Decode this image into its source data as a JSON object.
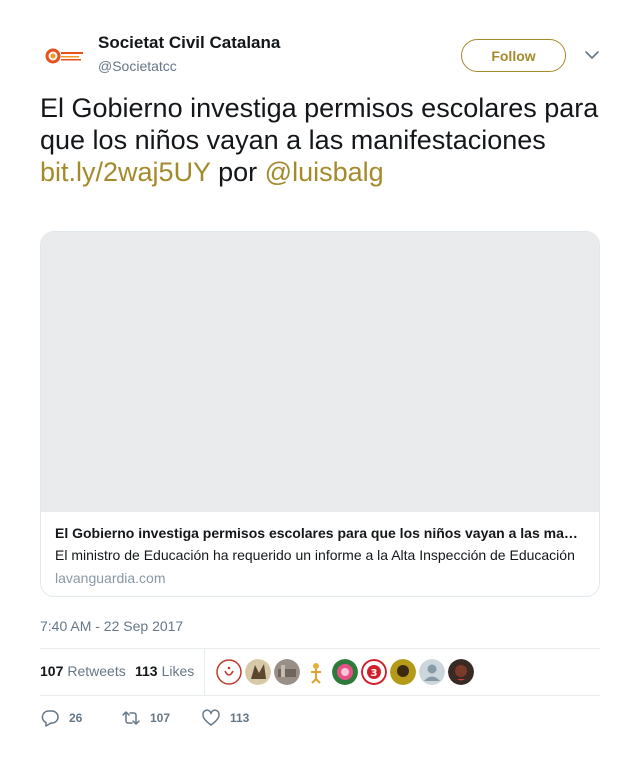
{
  "user": {
    "display_name": "Societat Civil Catalana",
    "handle": "@Societatcc",
    "avatar": "societat-civil-catalana-logo"
  },
  "follow_label": "Follow",
  "tweet": {
    "text_plain": "El Gobierno investiga permisos escolares para que los niños vayan a las manifestaciones",
    "link": "bit.ly/2waj5UY",
    "connector": "por",
    "mention": "@luisbalg"
  },
  "card": {
    "title": "El Gobierno investiga permisos escolares para que los niños vayan a las manifestaciones",
    "description": "El ministro de Educación ha requerido un informe a la Alta Inspección de Educación",
    "domain": "lavanguardia.com"
  },
  "timestamp": "7:40 AM - 22 Sep 2017",
  "stats": {
    "retweets_count": "107",
    "retweets_label": "Retweets",
    "likes_count": "113",
    "likes_label": "Likes"
  },
  "liker_avatars": [
    "liker-avatar-1",
    "liker-avatar-2",
    "liker-avatar-3",
    "liker-avatar-4",
    "liker-avatar-5",
    "liker-avatar-6",
    "liker-avatar-7",
    "liker-avatar-8",
    "liker-avatar-9"
  ],
  "actions": {
    "replies": "26",
    "retweets": "107",
    "likes": "113"
  },
  "colors": {
    "accent": "#a48a2b",
    "text": "#14171a",
    "muted": "#657786",
    "border": "#e1e8ed"
  }
}
